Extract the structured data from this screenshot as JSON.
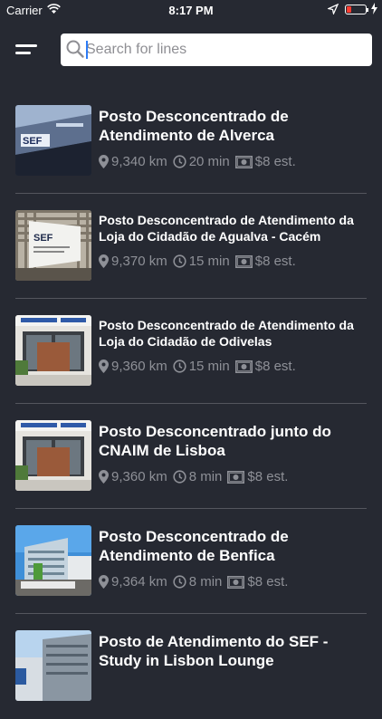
{
  "status_bar": {
    "carrier": "Carrier",
    "time": "8:17 PM"
  },
  "header": {
    "menu_icon": "hamburger-icon",
    "search": {
      "placeholder": "Search for lines",
      "value": ""
    }
  },
  "colors": {
    "background": "#262932",
    "meta_text": "#8e9097",
    "divider": "#54565e"
  },
  "items": [
    {
      "title": "Posto Desconcentrado de Atendimento de Alverca",
      "distance": "9,340 km",
      "time": "20 min",
      "price": "$8 est."
    },
    {
      "title": "Posto Desconcentrado de Atendimento da Loja do Cidadão de Agualva - Cacém",
      "distance": "9,370 km",
      "time": "15 min",
      "price": "$8 est."
    },
    {
      "title": "Posto Desconcentrado de Atendimento da Loja do Cidadão de Odivelas",
      "distance": "9,360 km",
      "time": "15 min",
      "price": "$8 est."
    },
    {
      "title": "Posto Desconcentrado junto do CNAIM de Lisboa",
      "distance": "9,360 km",
      "time": "8 min",
      "price": "$8 est."
    },
    {
      "title": "Posto Desconcentrado de Atendimento de Benfica",
      "distance": "9,364 km",
      "time": "8 min",
      "price": "$8 est."
    },
    {
      "title": "Posto de Atendimento do SEF - Study in Lisbon Lounge",
      "distance": "",
      "time": "",
      "price": ""
    }
  ]
}
